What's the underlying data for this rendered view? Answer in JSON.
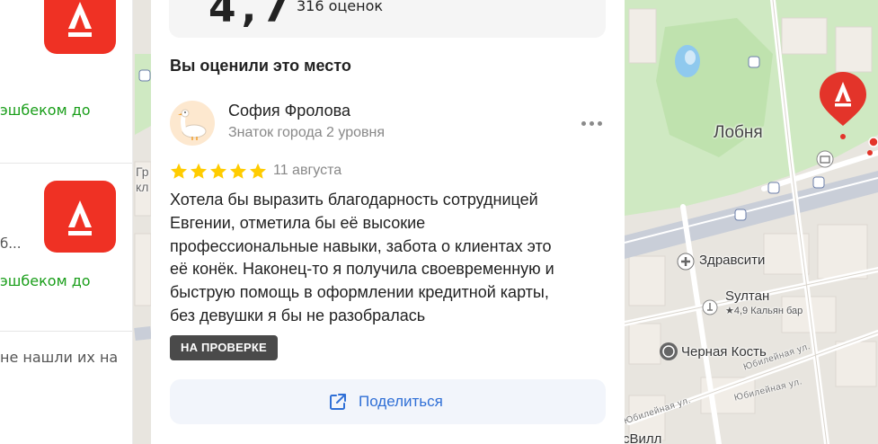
{
  "left_panel": {
    "cashback_1": "эшбеком до",
    "cashback_2": "эшбеком до",
    "partial_text": "б...",
    "not_found_text": "не нашли их на",
    "bank_logo_color": "#ef3124"
  },
  "rating": {
    "value": "4,7",
    "count": "316 оценок"
  },
  "review": {
    "section_title": "Вы оценили это место",
    "author_name": "София Фролова",
    "author_level": "Знаток города 2 уровня",
    "stars": 5,
    "date": "11 августа",
    "text_lines": [
      "Хотела бы выразить благодарность сотрудницей",
      "Евгении, отметила бы её высокие",
      "профессиональные навыки, забота о клиентах это",
      "её конёк. Наконец-то я получила своевременную и",
      "быструю помощь в оформлении кредитной карты,",
      "без девушки я бы не разобралась"
    ],
    "status_badge": "НА ПРОВЕРКЕ",
    "share_label": "Поделиться",
    "more_icon": "more-dots-icon",
    "star_color": "#fc0",
    "accent_color": "#2f6fd6"
  },
  "map": {
    "city_label": "Лобня",
    "poi_zdravsiti": "Здравсити",
    "poi_sultan": "Sултан",
    "poi_sultan_sub": "★4,9 Кальян бар",
    "poi_kost": "Черная Кость",
    "street_1": "Юбилейная ул.",
    "street_2": "Юбилейная ул.",
    "street_3": "Юбилейная ул.",
    "left_fragment_1": "Гр",
    "left_fragment_2": "кл",
    "bottom_label": "сВилл",
    "marker_letter": "А"
  }
}
